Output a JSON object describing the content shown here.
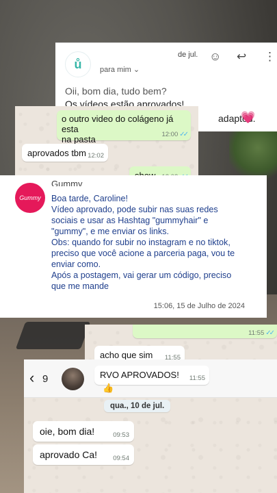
{
  "email": {
    "date": "de jul.",
    "recipient": "para mim",
    "chevron": "⌄",
    "line1": "Oii, bom dia, tudo bem?",
    "line2": "Os vídeos estão aprovados!",
    "line3": "adaptou.",
    "heart": "💗",
    "icons": [
      "emoji-icon",
      "reply-icon",
      "more-icon"
    ]
  },
  "chat1": {
    "messages": [
      {
        "dir": "out",
        "text_lines": [
          "o outro video do colágeno já esta",
          "na pasta"
        ],
        "time": "12:00",
        "ticks": "✓✓"
      },
      {
        "dir": "in",
        "text": "aprovados tbm",
        "time": "12:02"
      },
      {
        "dir": "out",
        "text": "show",
        "time": "12:02",
        "ticks": "✓✓"
      }
    ]
  },
  "gummy": {
    "logo_text": "Gummy",
    "sender": "Gummy",
    "lines": [
      "Boa tarde, Caroline!",
      "Vídeo aprovado, pode subir nas suas redes",
      "sociais e usar as Hashtag \"gummyhair\" e",
      "\"gummy\", e me enviar os links.",
      "Obs: quando for subir no instagram e no tiktok,",
      "preciso que você acione a parceria paga, vou te",
      "enviar como.",
      "Após a postagem, vai gerar um código, preciso",
      "que me mande"
    ],
    "timestamp": "15:06, 15 de Julho de 2024"
  },
  "chat2": {
    "messages": [
      {
        "dir": "out",
        "time": "11:55",
        "ticks": "✓✓"
      },
      {
        "dir": "in",
        "text": "acho que sim",
        "time": "11:55"
      },
      {
        "dir": "in",
        "text": "RVO APROVADOS!",
        "time": "11:55"
      }
    ]
  },
  "chat3": {
    "back_glyph": "‹",
    "unread": "9",
    "reaction": "👍",
    "date_pill": "qua., 10 de jul.",
    "messages": [
      {
        "dir": "in",
        "text": "oie, bom dia!",
        "time": "09:53"
      },
      {
        "dir": "in",
        "text": "aprovado Ca!",
        "time": "09:54"
      }
    ]
  }
}
